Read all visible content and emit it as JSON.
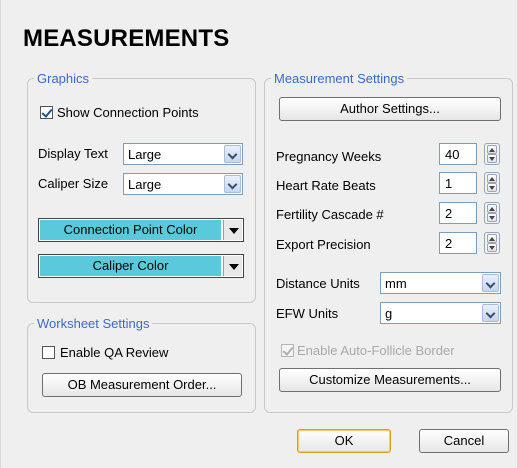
{
  "title": "MEASUREMENTS",
  "graphics": {
    "legend": "Graphics",
    "show_connection_points": {
      "label": "Show Connection Points",
      "checked": true
    },
    "display_text": {
      "label": "Display Text",
      "value": "Large"
    },
    "caliper_size": {
      "label": "Caliper Size",
      "value": "Large"
    },
    "connection_point_color": {
      "label": "Connection Point Color",
      "color": "#5bc9dc"
    },
    "caliper_color": {
      "label": "Caliper Color",
      "color": "#5bc9dc"
    }
  },
  "worksheet": {
    "legend": "Worksheet Settings",
    "enable_qa_review": {
      "label": "Enable QA Review",
      "checked": false
    },
    "ob_order_button": "OB Measurement Order..."
  },
  "measurement_settings": {
    "legend": "Measurement Settings",
    "author_button": "Author Settings...",
    "pregnancy_weeks": {
      "label": "Pregnancy Weeks",
      "value": "40"
    },
    "heart_rate_beats": {
      "label": "Heart Rate Beats",
      "value": "1"
    },
    "fertility_cascade": {
      "label": "Fertility Cascade #",
      "value": "2"
    },
    "export_precision": {
      "label": "Export Precision",
      "value": "2"
    },
    "distance_units": {
      "label": "Distance Units",
      "value": "mm"
    },
    "efw_units": {
      "label": "EFW Units",
      "value": "g"
    },
    "auto_follicle": {
      "label": "Enable Auto-Follicle Border",
      "checked": true,
      "enabled": false
    },
    "customize_button": "Customize Measurements..."
  },
  "footer": {
    "ok": "OK",
    "cancel": "Cancel"
  }
}
